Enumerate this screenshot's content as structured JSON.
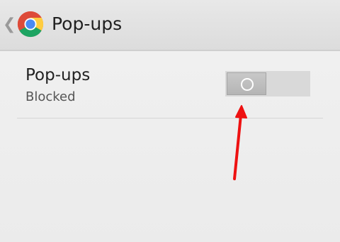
{
  "action_bar": {
    "title": "Pop-ups",
    "back_icon": "chevron-left-icon",
    "app_icon": "chrome-logo-icon"
  },
  "preference": {
    "title": "Pop-ups",
    "summary": "Blocked",
    "switch_state": "off"
  },
  "annotation": {
    "arrow_color": "#ee1111"
  },
  "colors": {
    "background": "#eeeeee",
    "action_bar": "#e0e0e0",
    "switch_track": "#d9d9d9"
  }
}
